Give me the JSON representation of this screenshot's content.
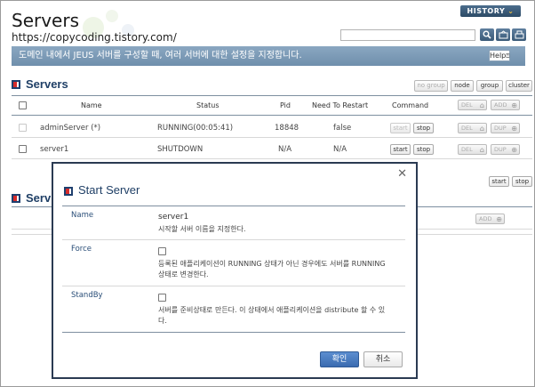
{
  "page": {
    "title": "Servers",
    "url": "https://copycoding.tistory.com/",
    "history_label": "HISTORY",
    "search": {
      "value": "",
      "placeholder": ""
    },
    "description": "도메인 내에서 JEUS 서버를 구성할 때, 여러 서버에 대한 설정을 지정합니다.",
    "help_label": "Help"
  },
  "servers_section": {
    "title": "Servers",
    "filters": [
      "no group",
      "node",
      "group",
      "cluster"
    ],
    "columns": {
      "name": "Name",
      "status": "Status",
      "pid": "Pid",
      "need_restart": "Need To Restart",
      "command": "Command"
    },
    "rows": [
      {
        "name": "adminServer (*)",
        "status": "RUNNING(00:05:41)",
        "pid": "18848",
        "need_restart": "false",
        "start": "start",
        "stop": "stop",
        "del": "DEL",
        "dup": "DUP"
      },
      {
        "name": "server1",
        "status": "SHUTDOWN",
        "pid": "N/A",
        "need_restart": "N/A",
        "start": "start",
        "stop": "stop",
        "del": "DEL",
        "dup": "DUP"
      }
    ],
    "add_label": "ADD",
    "bulk_start": "start",
    "bulk_stop": "stop"
  },
  "second_section": {
    "title_partial": "Serv",
    "add_label": "ADD"
  },
  "modal": {
    "title": "Start Server",
    "fields": [
      {
        "label": "Name",
        "value": "server1",
        "help": "시작할 서버 이름을 지정한다."
      },
      {
        "label": "Force",
        "help": "등록된 애플리케이션이 RUNNING 상태가 아닌 경우에도 서버를 RUNNING 상태로 변경한다."
      },
      {
        "label": "StandBy",
        "help": "서버를 준비상태로 만든다. 이 상태에서 애플리케이션을 distribute 할 수 있다."
      }
    ],
    "ok_label": "확인",
    "cancel_label": "취소"
  }
}
